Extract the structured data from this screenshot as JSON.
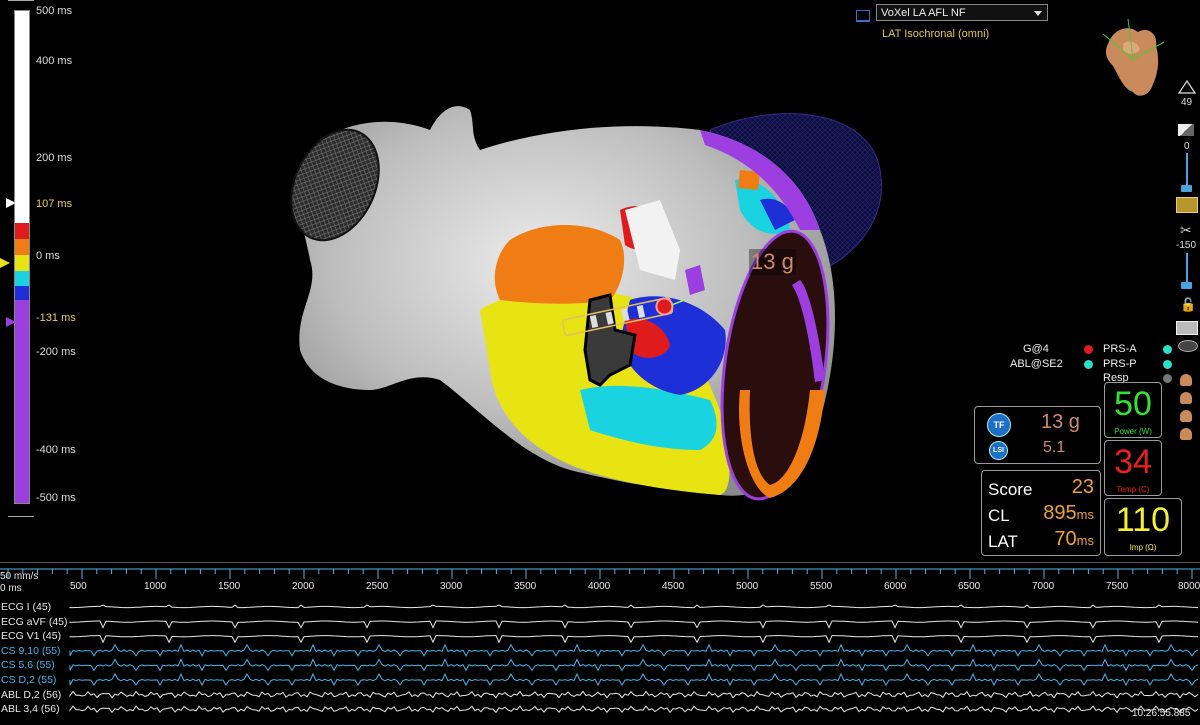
{
  "colorbar": {
    "labels": [
      {
        "text": "500 ms",
        "color": "#dddddd"
      },
      {
        "text": "400 ms",
        "color": "#dddddd"
      },
      {
        "text": "200 ms",
        "color": "#dddddd"
      },
      {
        "text": "107 ms",
        "color": "#e6d24a"
      },
      {
        "text": "0 ms",
        "color": "#dddddd"
      },
      {
        "text": "-131 ms",
        "color": "#e6d24a"
      },
      {
        "text": "-200 ms",
        "color": "#dddddd"
      },
      {
        "text": "-400 ms",
        "color": "#dddddd"
      },
      {
        "text": "-500 ms",
        "color": "#dddddd"
      }
    ],
    "segments": [
      "#e01b1b",
      "#f07d14",
      "#e8e414",
      "#19d4e0",
      "#1f2fd8",
      "#9d3fe0"
    ],
    "top_color": "#ffffff",
    "bottom_color": "#9d3fe0"
  },
  "map": {
    "selector": "VoXel LA AFL NF",
    "subtitle": "LAT Isochronal (omni)",
    "force_label": "13 g"
  },
  "toolbar": {
    "triangle_value": "49",
    "opacity_value": "0",
    "threshold_value": "-150"
  },
  "legend": {
    "left": [
      {
        "label": "G@4",
        "color": "#e01b1b"
      },
      {
        "label": "ABL@SE2",
        "color": "#29e0c8"
      }
    ],
    "right": [
      {
        "label": "PRS-A",
        "color": "#29e0c8"
      },
      {
        "label": "PRS-P",
        "color": "#29e0c8"
      },
      {
        "label": "Resp",
        "color": "#777777"
      }
    ]
  },
  "tf_panel": {
    "tf_badge": "TF",
    "lsi_badge": "LSI",
    "force": "13 g",
    "lsi": "5.1"
  },
  "score_panel": {
    "score_label": "Score",
    "score_value": "23",
    "cl_label": "CL",
    "cl_value": "895",
    "cl_unit": "ms",
    "lat_label": "LAT",
    "lat_value": "70",
    "lat_unit": "ms"
  },
  "ablation": {
    "power": "50",
    "power_label": "Power (W)",
    "temp": "34",
    "temp_label": "Temp (C)",
    "imp": "110",
    "imp_label": "Imp (Ω)"
  },
  "timeline": {
    "speed_label": "50 mm/s",
    "start_label": "0 ms",
    "ticks": [
      "500",
      "1000",
      "1500",
      "2000",
      "2500",
      "3000",
      "3500",
      "4000",
      "4500",
      "5000",
      "5500",
      "6000",
      "6500",
      "7000",
      "7500",
      "8000"
    ],
    "channels": [
      {
        "label": "ECG I (45)",
        "color": "#e8e8e8"
      },
      {
        "label": "ECG aVF (45)",
        "color": "#e8e8e8"
      },
      {
        "label": "ECG V1 (45)",
        "color": "#e8e8e8"
      },
      {
        "label": "CS 9,10 (55)",
        "color": "#3fb6ee"
      },
      {
        "label": "CS 5,6 (55)",
        "color": "#3fb6ee"
      },
      {
        "label": "CS D,2 (55)",
        "color": "#3fb6ee"
      },
      {
        "label": "ABL D,2 (56)",
        "color": "#e8e8e8"
      },
      {
        "label": "ABL 3,4 (56)",
        "color": "#e8e8e8"
      }
    ],
    "clock": "10:26:55.885"
  }
}
